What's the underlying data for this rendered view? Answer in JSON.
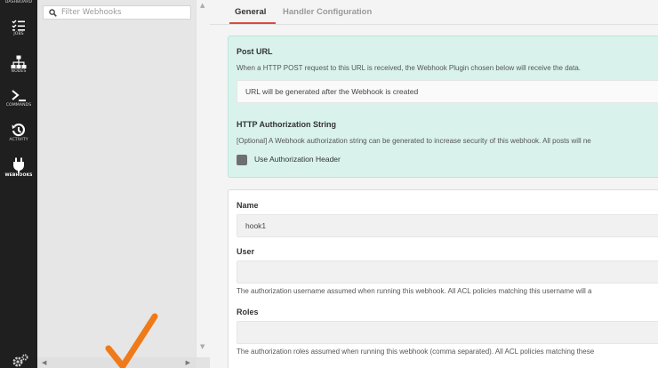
{
  "nav": {
    "items": [
      {
        "label": "DASHBOARD",
        "icon": "dashboard-icon",
        "active": false
      },
      {
        "label": "JOBS",
        "icon": "checklist-icon",
        "active": false
      },
      {
        "label": "NODES",
        "icon": "nodes-icon",
        "active": false
      },
      {
        "label": "COMMANDS",
        "icon": "terminal-icon",
        "active": false
      },
      {
        "label": "ACTIVITY",
        "icon": "history-icon",
        "active": false
      },
      {
        "label": "WEBHOOKS",
        "icon": "plug-icon",
        "active": true
      }
    ],
    "settings_icon": "gear-icon"
  },
  "list_panel": {
    "filter_placeholder": "Filter Webhooks"
  },
  "tabs": [
    {
      "label": "General",
      "active": true
    },
    {
      "label": "Handler Configuration",
      "active": false
    }
  ],
  "post_url": {
    "title": "Post URL",
    "description": "When a HTTP POST request to this URL is received, the Webhook Plugin chosen below will receive the data.",
    "value": "URL will be generated after the Webhook is created"
  },
  "auth": {
    "title": "HTTP Authorization String",
    "description": "[Optional] A Webhook authorization string can be generated to increase security of this webhook. All posts will ne",
    "checkbox_label": "Use Authorization Header",
    "checked": false
  },
  "form": {
    "name_label": "Name",
    "name_value": "hook1",
    "user_label": "User",
    "user_value": "",
    "user_help": "The authorization username assumed when running this webhook. All ACL policies matching this username will a",
    "roles_label": "Roles",
    "roles_value": "",
    "roles_help": "The authorization roles assumed when running this webhook (comma separated). All ACL policies matching these"
  },
  "colors": {
    "nav_bg": "#1f1f1f",
    "accent": "#d94b3f",
    "teal_card": "#d9f3ec",
    "checkmark": "#f07a1a"
  }
}
